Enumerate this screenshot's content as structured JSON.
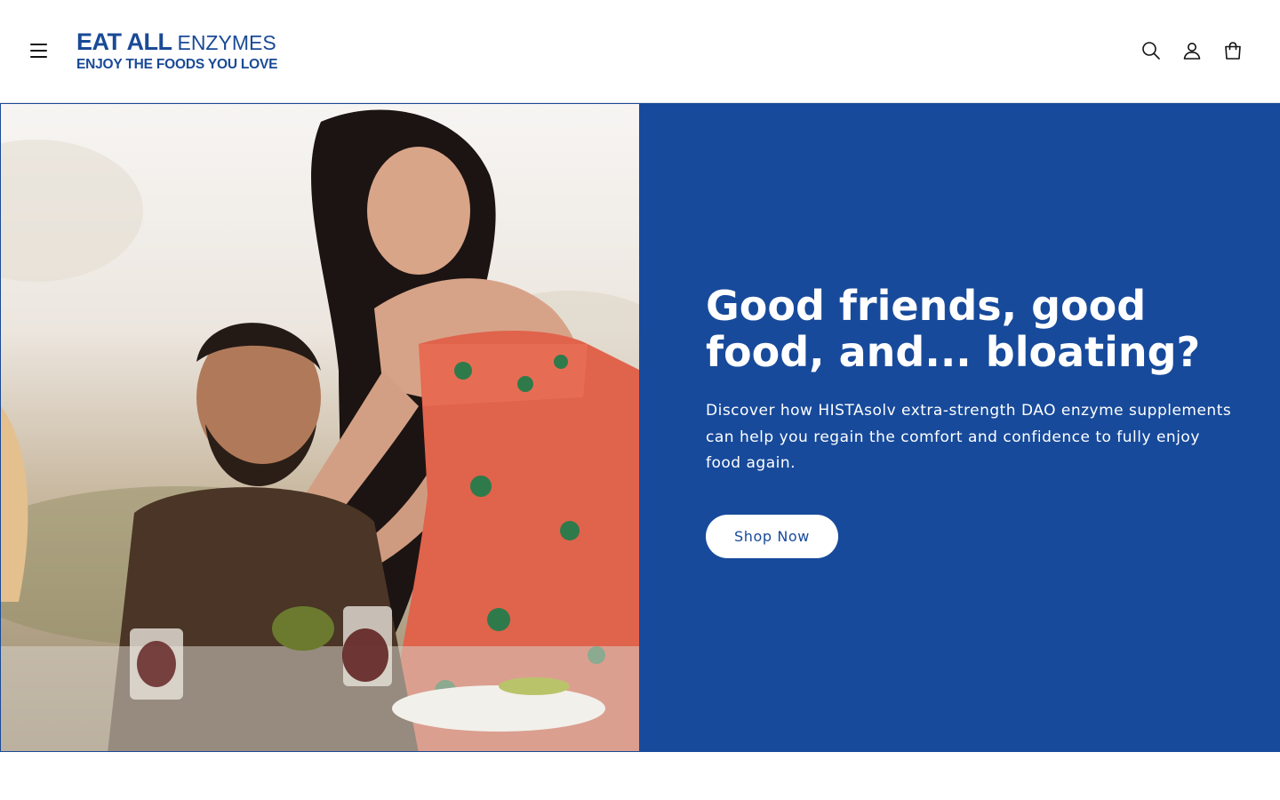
{
  "header": {
    "menu_icon": "hamburger-menu-icon",
    "logo": {
      "line1_bold": "EAT ALL",
      "line1_light": "ENZYMES",
      "line2": "ENJOY THE FOODS YOU LOVE"
    },
    "icons": [
      "search-icon",
      "account-icon",
      "cart-icon"
    ]
  },
  "hero": {
    "image_alt": "Friends sharing a meal outdoors",
    "title": "Good friends, good food, and... bloating?",
    "text": "Discover how HISTAsolv extra-strength DAO enzyme supplements can help you regain the comfort and confidence to fully enjoy food again.",
    "button_label": "Shop Now"
  },
  "colors": {
    "brand_blue": "#174a9b",
    "logo_blue": "#1a4a96",
    "background": "#ffffff"
  }
}
